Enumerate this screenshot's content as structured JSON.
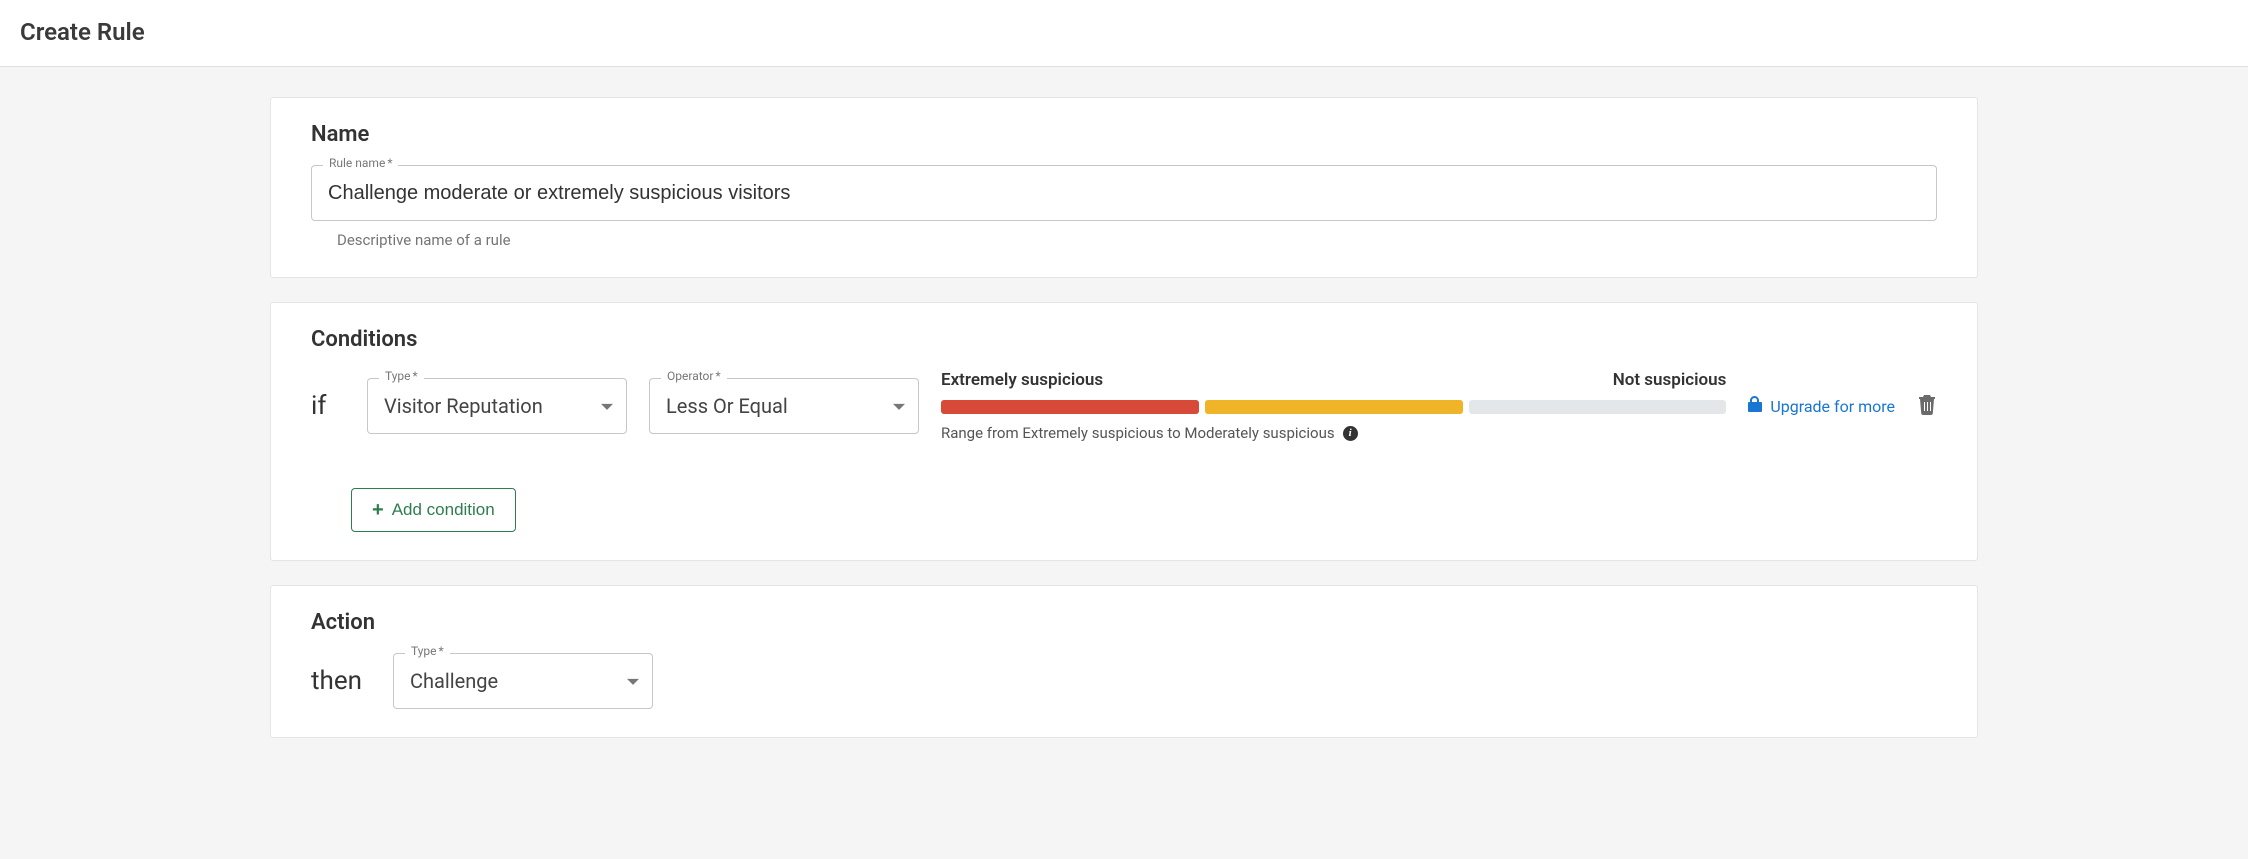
{
  "header": {
    "title": "Create Rule"
  },
  "name_section": {
    "title": "Name",
    "field_label": "Rule name",
    "value": "Challenge moderate or extremely suspicious visitors",
    "helper": "Descriptive name of a rule"
  },
  "conditions_section": {
    "title": "Conditions",
    "keyword": "if",
    "type_label": "Type",
    "type_value": "Visitor Reputation",
    "operator_label": "Operator",
    "operator_value": "Less Or Equal",
    "range_left": "Extremely suspicious",
    "range_right": "Not suspicious",
    "range_caption": "Range from Extremely suspicious to Moderately suspicious",
    "upgrade_text": "Upgrade for more",
    "add_button": "Add condition"
  },
  "action_section": {
    "title": "Action",
    "keyword": "then",
    "type_label": "Type",
    "type_value": "Challenge"
  }
}
